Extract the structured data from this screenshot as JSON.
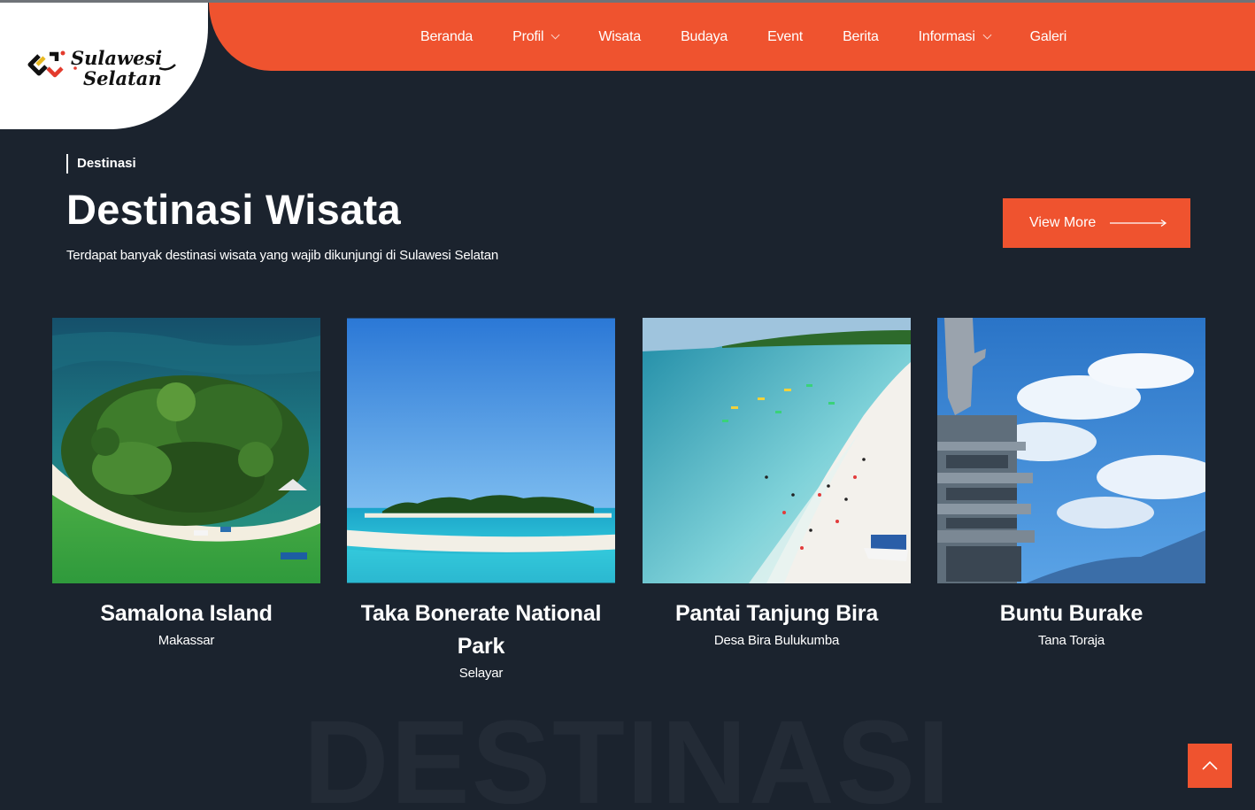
{
  "brand": {
    "logo_text_line1": "Sulawesi",
    "logo_text_line2": "Selatan",
    "accent_color": "#ef532f"
  },
  "nav": {
    "items": [
      {
        "label": "Beranda",
        "has_dropdown": false
      },
      {
        "label": "Profil",
        "has_dropdown": true
      },
      {
        "label": "Wisata",
        "has_dropdown": false
      },
      {
        "label": "Budaya",
        "has_dropdown": false
      },
      {
        "label": "Event",
        "has_dropdown": false
      },
      {
        "label": "Berita",
        "has_dropdown": false
      },
      {
        "label": "Informasi",
        "has_dropdown": true
      },
      {
        "label": "Galeri",
        "has_dropdown": false
      }
    ]
  },
  "section": {
    "eyebrow": "Destinasi",
    "title": "Destinasi Wisata",
    "subtitle": "Terdapat banyak destinasi wisata yang wajib dikunjungi di Sulawesi Selatan",
    "view_more_label": "View More",
    "watermark": "DESTINASI"
  },
  "destinations": [
    {
      "name": "Samalona Island",
      "location": "Makassar",
      "image": "island-aerial-photo"
    },
    {
      "name": "Taka Bonerate National Park",
      "location": "Selayar",
      "image": "island-horizon-photo"
    },
    {
      "name": "Pantai Tanjung Bira",
      "location": "Desa Bira Bulukumba",
      "image": "beach-aerial-photo"
    },
    {
      "name": "Buntu Burake",
      "location": "Tana Toraja",
      "image": "statue-tower-photo"
    }
  ],
  "icons": {
    "dropdown": "chevron-down-icon",
    "view_more_arrow": "arrow-right-icon",
    "scroll_top": "chevron-up-icon"
  }
}
